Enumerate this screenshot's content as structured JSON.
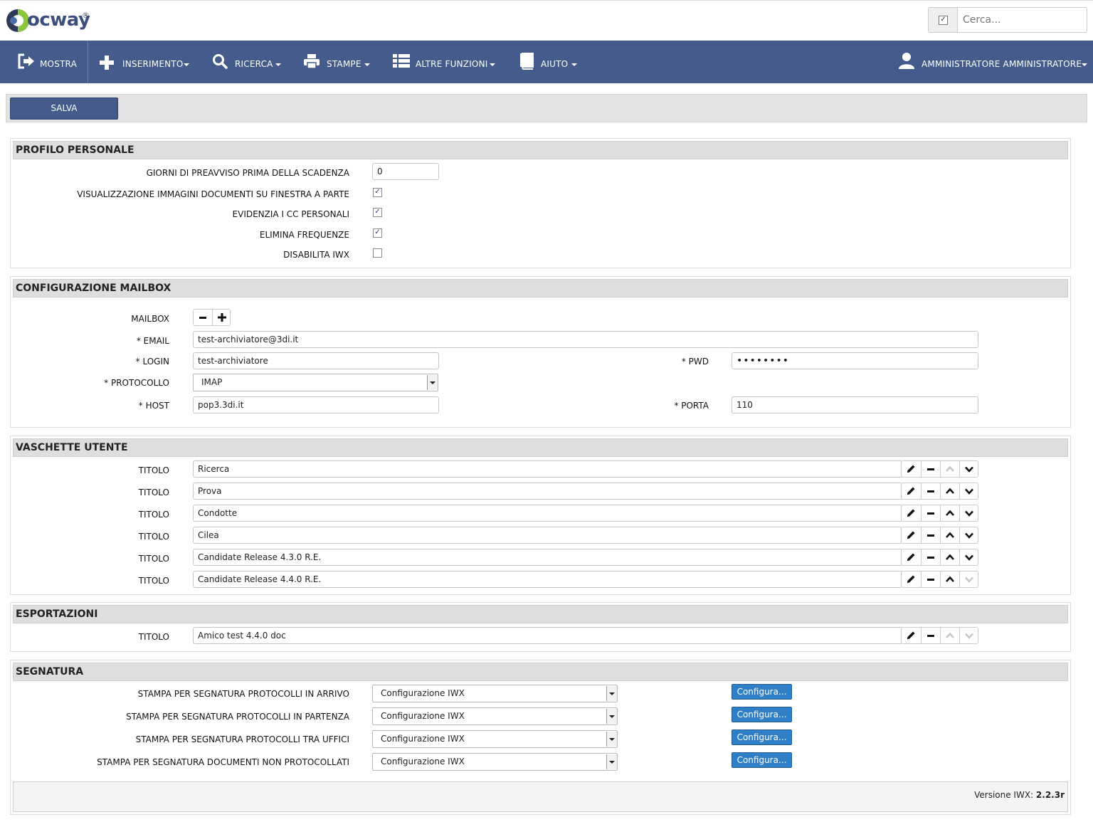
{
  "app": {
    "logo_text": "ocway",
    "logo_mark": "D",
    "registered": "®"
  },
  "search": {
    "placeholder": "Cerca...",
    "checkbox_checked": true
  },
  "nav": {
    "mostra": "MOSTRA",
    "inserimento": "INSERIMENTO",
    "ricerca": "RICERCA",
    "stampe": "STAMPE",
    "altre_funzioni": "ALTRE FUNZIONI",
    "aiuto": "AIUTO",
    "user": "AMMINISTRATORE AMMINISTRATORE"
  },
  "toolbar": {
    "save_label": "SALVA"
  },
  "profilo": {
    "title": "PROFILO PERSONALE",
    "giorni_label": "GIORNI DI PREAVVISO PRIMA DELLA SCADENZA",
    "giorni_value": "0",
    "visual_label": "VISUALIZZAZIONE IMMAGINI DOCUMENTI SU FINESTRA A PARTE",
    "visual_checked": true,
    "evidenzia_label": "EVIDENZIA I CC PERSONALI",
    "evidenzia_checked": true,
    "elimina_label": "ELIMINA FREQUENZE",
    "elimina_checked": true,
    "disabilita_label": "DISABILITA IWX",
    "disabilita_checked": false
  },
  "mailbox": {
    "title": "CONFIGURAZIONE MAILBOX",
    "mailbox_label": "MAILBOX",
    "email_label": "* EMAIL",
    "email_value": "test-archiviatore@3di.it",
    "login_label": "* LOGIN",
    "login_value": "test-archiviatore",
    "pwd_label": "* PWD",
    "pwd_value": "••••••••",
    "protocollo_label": "* PROTOCOLLO",
    "protocollo_value": "IMAP",
    "host_label": "* HOST",
    "host_value": "pop3.3di.it",
    "porta_label": "* PORTA",
    "porta_value": "110"
  },
  "vaschette": {
    "title": "VASCHETTE UTENTE",
    "row_label": "TITOLO",
    "rows": [
      "Ricerca",
      "Prova",
      "Condotte",
      "Cilea",
      "Candidate Release 4.3.0 R.E.",
      "Candidate Release 4.4.0 R.E."
    ]
  },
  "esportazioni": {
    "title": "ESPORTAZIONI",
    "row_label": "TITOLO",
    "rows": [
      "Amico test 4.4.0 doc"
    ]
  },
  "segnatura": {
    "title": "SEGNATURA",
    "configure_label": "Configura...",
    "rows": [
      {
        "label": "STAMPA PER SEGNATURA PROTOCOLLI IN ARRIVO",
        "value": "Configurazione IWX"
      },
      {
        "label": "STAMPA PER SEGNATURA PROTOCOLLI IN PARTENZA",
        "value": "Configurazione IWX"
      },
      {
        "label": "STAMPA PER SEGNATURA PROTOCOLLI TRA UFFICI",
        "value": "Configurazione IWX"
      },
      {
        "label": "STAMPA PER SEGNATURA DOCUMENTI NON PROTOCOLLATI",
        "value": "Configurazione IWX"
      }
    ]
  },
  "footer": {
    "version_label": "Versione IWX: ",
    "version_value": "2.2.3r"
  },
  "colors": {
    "nav_bg": "#445b8c",
    "configure_bg": "#2f7fc7",
    "section_header_bg": "#dedede"
  }
}
